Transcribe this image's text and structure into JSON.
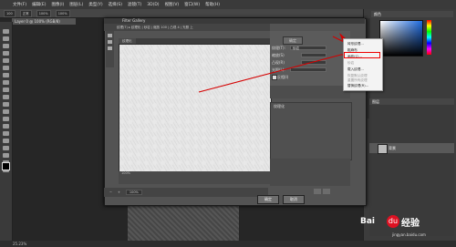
{
  "app": {
    "menus": [
      "文件(F)",
      "编辑(E)",
      "图像(I)",
      "图层(L)",
      "类型(Y)",
      "选择(S)",
      "滤镜(T)",
      "3D(D)",
      "视图(V)",
      "窗口(W)",
      "帮助(H)"
    ],
    "options": {
      "size_label": "100",
      "mode_label": "正常",
      "opacity_label": "100%",
      "flow_label": "100%"
    },
    "doc_tab": "Layer 0 @ 100% (RGB/8)",
    "status": "25.23%"
  },
  "dialog": {
    "title": "Filter Gallery",
    "toolbar_text": "纹理(T) ▸ 纹理化 | 砂岩 | 缩放 100 | 凸现 4 | 光照 上",
    "tabs": [
      "纹理化"
    ],
    "preview_info": "100%",
    "zoom_value": "100%",
    "ok_label": "确定",
    "cancel_label": "取消",
    "settings": {
      "texture_label": "纹理(T):",
      "texture_value": "砂岩",
      "scaling_label": "缩放(S)",
      "relief_label": "凸现(R)",
      "light_label": "光照(L):",
      "invert_label": "反相(I)",
      "top_ok": "确定"
    },
    "effect_layer_label": "纹理化"
  },
  "popup_menu": {
    "items": [
      "砖形纹理...",
      "粗麻布",
      "画布(C)...",
      "砂岩",
      "载入纹理...",
      "",
      "恢复默认纹理",
      "重置所有纹理"
    ],
    "highlighted_index": 2,
    "last_item": "替换纹理(R)..."
  },
  "panels": {
    "color_tab": "颜色",
    "layers_tab": "图层",
    "layer_name": "背景"
  },
  "watermark": {
    "logo": "Bai",
    "paw": "du",
    "text": "经验",
    "url": "jingyan.baidu.com"
  }
}
